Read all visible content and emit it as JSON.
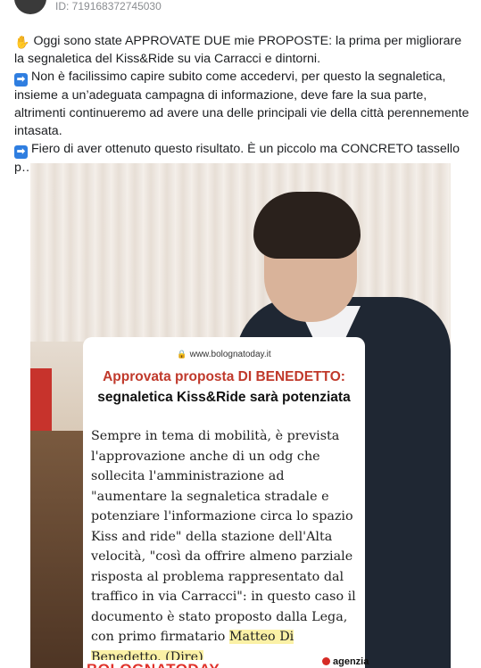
{
  "header": {
    "post_id": "ID: 719168372745030"
  },
  "post": {
    "line1_icon": "raised-hand-icon",
    "line1": "Oggi sono state APPROVATE DUE mie PROPOSTE: la prima per migliorare la segnaletica del Kiss&Ride su via Carracci e dintorni.",
    "line2_icon": "right-arrow-icon",
    "line2": "Non è facilissimo capire subito come accedervi, per questo la segnaletica, insieme a un’adeguata campagna di informazione, deve fare la sua parte, altrimenti continueremo ad avere una delle principali vie della città perennemente intasata.",
    "line3_icon": "right-arrow-icon",
    "line3": "Fiero di aver ottenuto questo risultato. È un piccolo ma CONCRETO tassello p…"
  },
  "image": {
    "url": "www.bolognatoday.it",
    "title_red": "Approvata proposta DI BENEDETTO:",
    "title_black": "segnaletica Kiss&Ride sarà potenziata",
    "body_main": "Sempre in tema di mobilità, è prevista l'approvazione anche di un odg che sollecita l'amministrazione ad \"aumentare la segnaletica stradale e potenziare l'informazione circa lo spazio Kiss and ride\" della stazione dell'Alta velocità, \"così da offrire almeno parziale risposta al problema rappresentato dal traffico in via Carracci\": in questo caso il documento è stato proposto dalla Lega, con primo firmatario ",
    "body_highlight": "Matteo Di Benedetto. (Dire)",
    "brand": "BOLOGNATODAY",
    "agency": "agenzia"
  },
  "colors": {
    "title_red": "#c0392b",
    "brand_red": "#e0322b",
    "highlight": "#fbf1a6",
    "arrow_blue": "#2f7ee0"
  }
}
